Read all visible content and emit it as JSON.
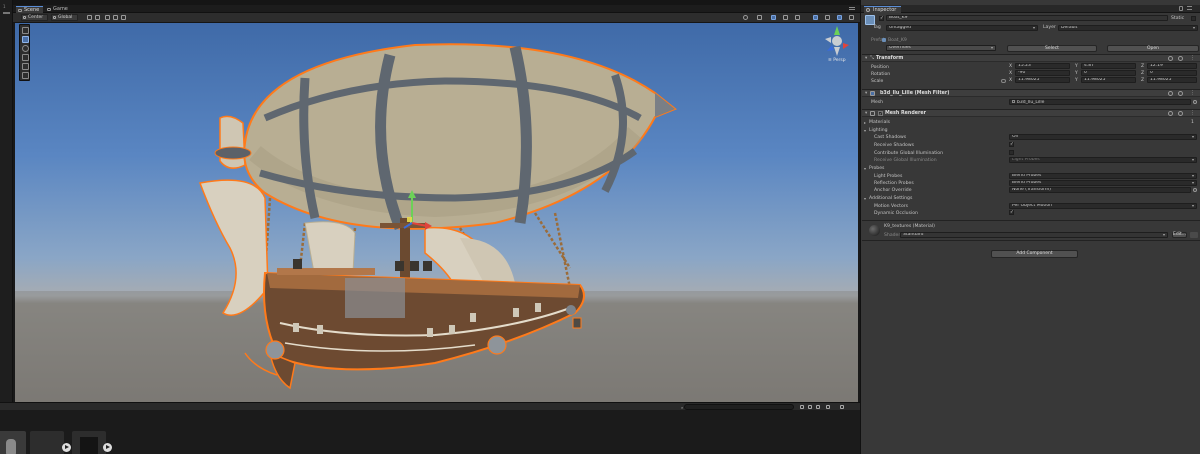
{
  "top": {
    "left_label": "1"
  },
  "scene_view": {
    "tabs": [
      {
        "label": "Scene"
      },
      {
        "label": "Game"
      }
    ],
    "toolbar": {
      "pivot_label": "Center",
      "space_label": "Global"
    },
    "perspective_label": "≡ Persp"
  },
  "inspector": {
    "tab_label": "Inspector",
    "object": {
      "name": "Boat_K9",
      "static_label": "Static",
      "tag_label": "Tag",
      "tag_value": "Untagged",
      "layer_label": "Layer",
      "layer_value": "Default",
      "prefab_label": "Prefab",
      "prefab_value": "Boat_K9",
      "overrides_label": "Overrides",
      "select_label": "Select",
      "open_label": "Open"
    },
    "transform": {
      "title": "Transform",
      "rows": [
        {
          "label": "Position",
          "x": "15.23",
          "y": "4.87",
          "z": "12.19"
        },
        {
          "label": "Rotation",
          "x": "-90",
          "y": "0",
          "z": "0"
        },
        {
          "label": "Scale",
          "x": "11.98025",
          "y": "11.98025",
          "z": "11.98025"
        }
      ]
    },
    "mesh_filter": {
      "title": "b3d_llu_Lille (Mesh Filter)",
      "mesh_label": "Mesh",
      "mesh_value": "b3d_llu_Lille"
    },
    "mesh_renderer": {
      "title": "Mesh Renderer",
      "materials_label": "Materials",
      "materials_count": "1",
      "lighting_label": "Lighting",
      "cast_shadows_label": "Cast Shadows",
      "cast_shadows_value": "On",
      "receive_shadows_label": "Receive Shadows",
      "contribute_gi_label": "Contribute Global Illumination",
      "receive_gi_label": "Receive Global Illumination",
      "receive_gi_value": "Light Probes",
      "probes_label": "Probes",
      "light_probes_label": "Light Probes",
      "light_probes_value": "Blend Probes",
      "reflection_probes_label": "Reflection Probes",
      "reflection_probes_value": "Blend Probes",
      "anchor_override_label": "Anchor Override",
      "anchor_override_value": "None (Transform)",
      "additional_label": "Additional Settings",
      "motion_vectors_label": "Motion Vectors",
      "motion_vectors_value": "Per Object Motion",
      "dynamic_occlusion_label": "Dynamic Occlusion"
    },
    "material": {
      "title": "K9_textures (Material)",
      "shader_label": "Shader",
      "shader_value": "Standard",
      "edit_label": "Edit..."
    },
    "add_component_label": "Add Component"
  },
  "colors": {
    "selection_outline": "#ff7a1a",
    "accent_blue": "#4a6fa5",
    "inspector_bg": "#383838"
  },
  "icons": [
    "hand-tool-icon",
    "move-tool-icon",
    "rotate-tool-icon",
    "scale-tool-icon",
    "rect-tool-icon",
    "transform-tool-icon",
    "scene-gizmo-icon",
    "gameobject-cube-icon",
    "prefab-icon"
  ]
}
